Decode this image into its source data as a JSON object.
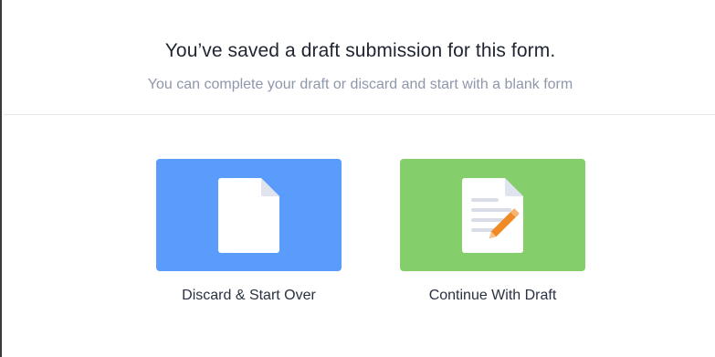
{
  "dialog": {
    "title": "You’ve saved a draft submission for this form.",
    "subtitle": "You can complete your draft or discard and start with a blank form"
  },
  "options": [
    {
      "label": "Discard & Start Over",
      "icon": "blank-document-icon",
      "color": "#5a9cfb"
    },
    {
      "label": "Continue With Draft",
      "icon": "document-edit-icon",
      "color": "#84cf6c"
    }
  ]
}
